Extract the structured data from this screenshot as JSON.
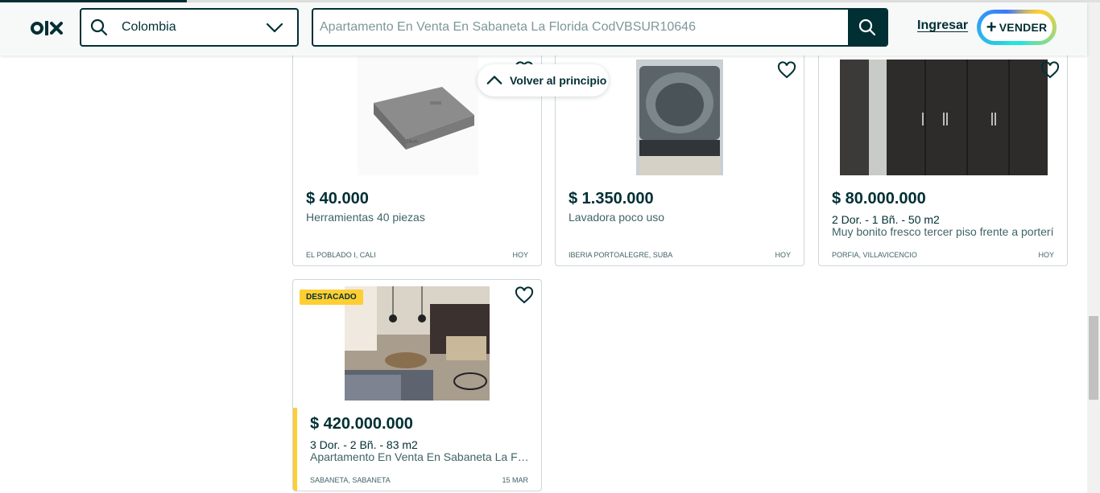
{
  "header": {
    "logo_text": "OLX",
    "location_value": "Colombia",
    "search_placeholder": "Apartamento En Venta En Sabaneta La Florida CodVBSUR10646",
    "login_label": "Ingresar",
    "sell_label": "VENDER"
  },
  "back_to_top": {
    "label": "Volver al principio"
  },
  "listings": [
    {
      "price": "$ 40.000",
      "details": "",
      "title": "Herramientas 40 piezas",
      "location": "EL POBLADO I, CALI",
      "date": "HOY",
      "featured": false
    },
    {
      "price": "$ 1.350.000",
      "details": "",
      "title": "Lavadora poco uso",
      "location": "IBERIA PORTOALEGRE, SUBA",
      "date": "HOY",
      "featured": false
    },
    {
      "price": "$ 80.000.000",
      "details": "2 Dor. - 1 Bñ. - 50 m2",
      "title": "Muy bonito fresco tercer piso frente a porterí",
      "location": "PORFIA, VILLAVICENCIO",
      "date": "HOY",
      "featured": false
    },
    {
      "price": "$ 420.000.000",
      "details": "3 Dor. - 2 Bñ. - 83 m2",
      "title": "Apartamento En Venta En Sabaneta La Florida",
      "location": "SABANETA, SABANETA",
      "date": "15 MAR",
      "featured": true,
      "badge": "DESTACADO"
    }
  ],
  "colors": {
    "brand": "#002f34",
    "featured": "#ffce32",
    "border": "#ced6d7"
  },
  "icons": [
    "olx-logo",
    "search-icon",
    "chevron-down-icon",
    "plus-icon",
    "heart-icon",
    "chevron-up-icon"
  ]
}
